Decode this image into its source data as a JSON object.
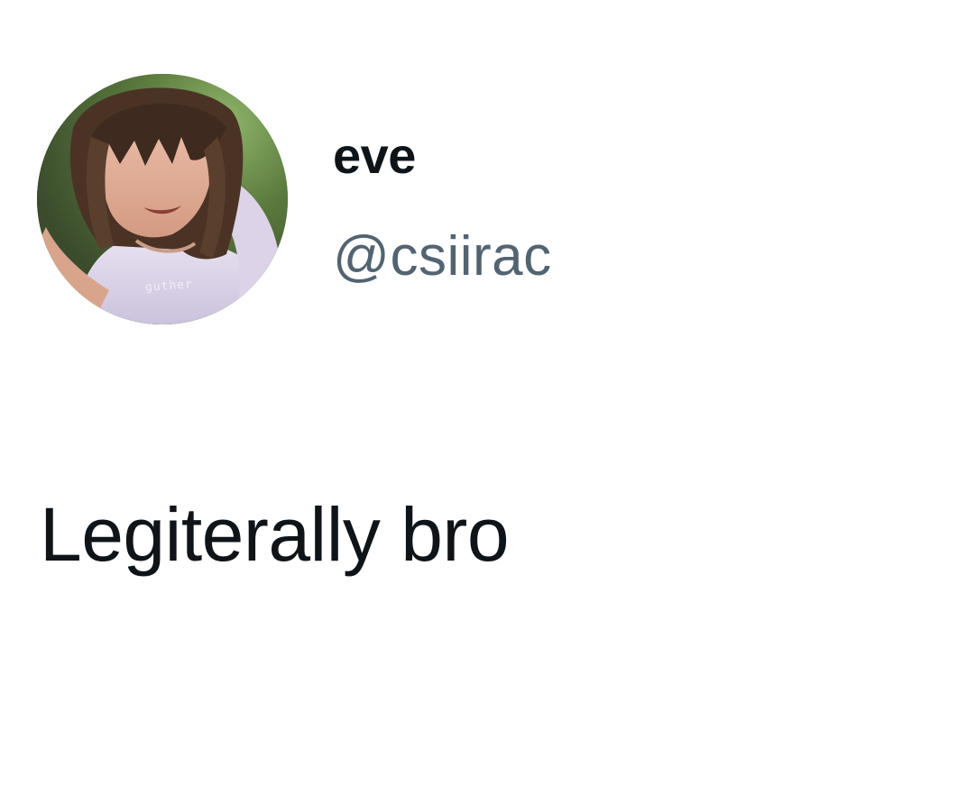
{
  "tweet": {
    "author": {
      "display_name": "eve",
      "handle": "@csiirac",
      "avatar_caption": "guther"
    },
    "text": "Legiterally bro"
  },
  "colors": {
    "background": "#ffffff",
    "primary_text": "#0f1419",
    "secondary_text": "#536471"
  }
}
